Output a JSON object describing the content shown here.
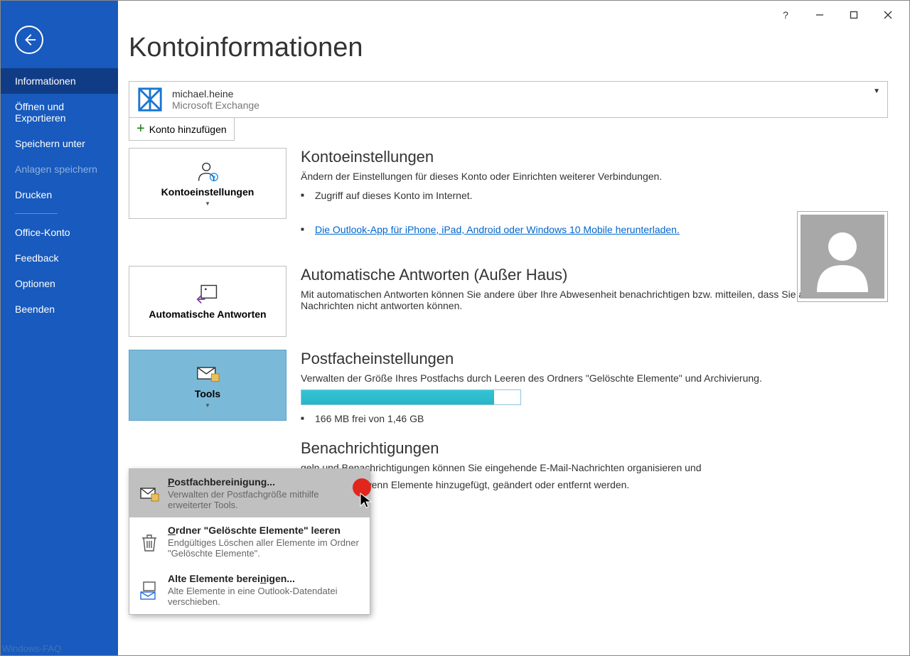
{
  "title": "Kontoinformationen",
  "titlebar": {
    "help": "?"
  },
  "sidebar": {
    "items": [
      {
        "label": "Informationen",
        "state": "active"
      },
      {
        "label": "Öffnen und Exportieren",
        "state": ""
      },
      {
        "label": "Speichern unter",
        "state": ""
      },
      {
        "label": "Anlagen speichern",
        "state": "disabled"
      },
      {
        "label": "Drucken",
        "state": ""
      },
      {
        "label": "Office-Konto",
        "state": ""
      },
      {
        "label": "Feedback",
        "state": ""
      },
      {
        "label": "Optionen",
        "state": ""
      },
      {
        "label": "Beenden",
        "state": ""
      }
    ]
  },
  "account": {
    "name": "michael.heine",
    "type": "Microsoft Exchange",
    "add_label": "Konto hinzufügen"
  },
  "sections": {
    "settings": {
      "tile": "Kontoeinstellungen",
      "heading": "Kontoeinstellungen",
      "desc": "Ändern der Einstellungen für dieses Konto oder Einrichten weiterer Verbindungen.",
      "bullet1": "Zugriff auf dieses Konto im Internet.",
      "bullet2_link": "Die Outlook-App für iPhone, iPad, Android oder Windows 10 Mobile herunterladen."
    },
    "autoreply": {
      "tile": "Automatische Antworten",
      "heading": "Automatische Antworten (Außer Haus)",
      "desc": "Mit automatischen Antworten können Sie andere über Ihre Abwesenheit benachrichtigen bzw. mitteilen, dass Sie auf E-Mail-Nachrichten nicht antworten können."
    },
    "mailbox": {
      "tile": "Tools",
      "heading": "Postfacheinstellungen",
      "desc": "Verwalten der Größe Ihres Postfachs durch Leeren des Ordners \"Gelöschte Elemente\" und Archivierung.",
      "usage": "166 MB frei von 1,46 GB",
      "progress_pct": 88
    },
    "rules": {
      "heading_suffix": "Benachrichtigungen",
      "desc_suffix_1": "geln und Benachrichtigungen können Sie eingehende E-Mail-Nachrichten organisieren und",
      "desc_suffix_2": "n empfangen, wenn Elemente hinzugefügt, geändert oder entfernt werden."
    }
  },
  "dropdown": {
    "items": [
      {
        "pre": "",
        "accel": "P",
        "post": "ostfachbereinigung...",
        "desc": "Verwalten der Postfachgröße mithilfe erweiterter Tools."
      },
      {
        "pre": "",
        "accel": "O",
        "post": "rdner \"Gelöschte Elemente\" leeren",
        "desc": "Endgültiges Löschen aller Elemente im Ordner \"Gelöschte Elemente\"."
      },
      {
        "pre": "Alte Elemente berei",
        "accel": "n",
        "post": "igen...",
        "desc": "Alte Elemente in eine Outlook-Datendatei verschieben."
      }
    ]
  },
  "watermark": "Windows-FAQ"
}
